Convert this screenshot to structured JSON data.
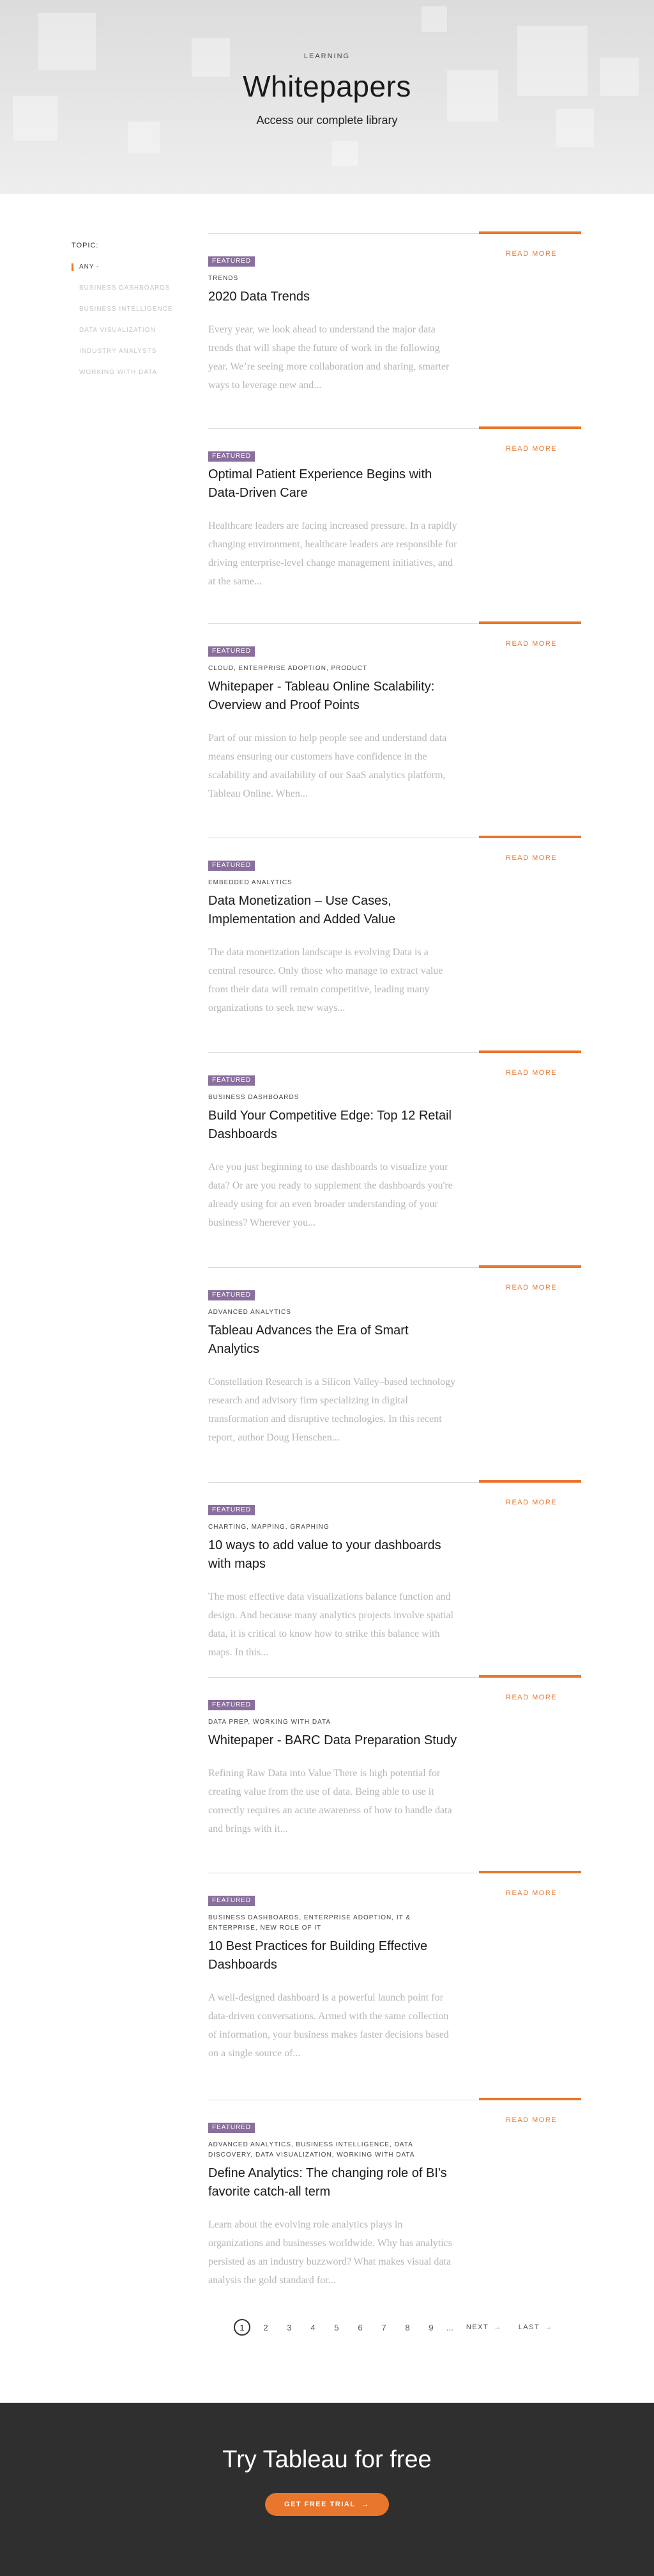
{
  "hero": {
    "eyebrow": "Learning",
    "title": "Whitepapers",
    "subtitle": "Access our complete library"
  },
  "filters": {
    "heading": "Topic:",
    "items": [
      {
        "label": "Any -",
        "active": true
      },
      {
        "label": "Business Dashboards",
        "active": false
      },
      {
        "label": "Business Intelligence",
        "active": false
      },
      {
        "label": "Data Visualization",
        "active": false
      },
      {
        "label": "Industry Analysts",
        "active": false
      },
      {
        "label": "Working With Data",
        "active": false
      }
    ]
  },
  "read_more_label": "Read more",
  "whitepapers": [
    {
      "badge": "Featured",
      "tags": "Trends",
      "title": "2020 Data Trends",
      "summary": "Every year, we look ahead to understand the major data trends that will shape the future of work in the following year. We’re seeing more collaboration and sharing, smarter ways to leverage new and..."
    },
    {
      "badge": "Featured",
      "tags": "",
      "title": "Optimal Patient Experience Begins with Data-Driven Care",
      "summary": "Healthcare leaders are facing increased pressure. In a rapidly changing environment, healthcare leaders are responsible for driving enterprise-level change management initiatives, and at the same..."
    },
    {
      "badge": "Featured",
      "tags": "Cloud, Enterprise Adoption, Product",
      "title": "Whitepaper - Tableau Online Scalability: Overview and Proof Points",
      "summary": "Part of our mission to help people see and understand data means ensuring our customers have confidence in the scalability and availability of our SaaS analytics platform, Tableau Online. When..."
    },
    {
      "badge": "Featured",
      "tags": "Embedded Analytics",
      "title": "Data Monetization – Use Cases, Implementation and Added Value",
      "summary": "The data monetization landscape is evolving Data is a central resource. Only those who manage to extract value from their data will remain competitive, leading many organizations to seek new ways..."
    },
    {
      "badge": "Featured",
      "tags": "Business Dashboards",
      "title": "Build Your Competitive Edge: Top 12 Retail Dashboards",
      "summary": "Are you just beginning to use dashboards to visualize your data? Or are you ready to supplement the dashboards you're already using for an even broader understanding of your business? Wherever you..."
    },
    {
      "badge": "Featured",
      "tags": "Advanced Analytics",
      "title": "Tableau Advances the Era of Smart Analytics",
      "summary": "Constellation Research is a Silicon Valley–based technology research and advisory firm specializing in digital transformation and disruptive technologies. In this recent report, author Doug Henschen..."
    },
    {
      "badge": "Featured",
      "tags": "Charting, Mapping, Graphing",
      "title": "10 ways to add value to your dashboards with maps",
      "summary": "The most effective data visualizations balance function and design. And because many analytics projects involve spatial data, it is critical to know how to strike this balance with maps. In this..."
    },
    {
      "badge": "Featured",
      "tags": "Data Prep, Working With Data",
      "title": "Whitepaper - BARC Data Preparation Study",
      "summary": "Refining Raw Data into Value There is high potential for creating value from the use of data. Being able to use it correctly requires an acute awareness of how to handle data and brings with it..."
    },
    {
      "badge": "Featured",
      "tags": "Business Dashboards, Enterprise Adoption, IT & Enterprise, New Role of IT",
      "title": "10 Best Practices for Building Effective Dashboards",
      "summary": "A well-designed dashboard is a powerful launch point for data-driven conversations. Armed with the same collection of information, your business makes faster decisions based on a single source of..."
    },
    {
      "badge": "Featured",
      "tags": "Advanced Analytics, Business Intelligence, Data Discovery, Data Visualization, Working With Data",
      "title": "Define Analytics: The changing role of BI's favorite catch-all term",
      "summary": "Learn about the evolving role analytics plays in organizations and businesses worldwide. Why has analytics persisted as an industry buzzword? What makes visual data analysis the gold standard for..."
    }
  ],
  "pagination": {
    "pages": [
      "1",
      "2",
      "3",
      "4",
      "5",
      "6",
      "7",
      "8",
      "9"
    ],
    "current": "1",
    "ellipsis": "...",
    "next": "Next",
    "last": "Last"
  },
  "cta": {
    "title": "Try Tableau for free",
    "button": "Get free trial"
  },
  "colors": {
    "accent": "#e8762d",
    "badge": "#8a6f9e",
    "footer_bg": "#2f2f2f"
  }
}
